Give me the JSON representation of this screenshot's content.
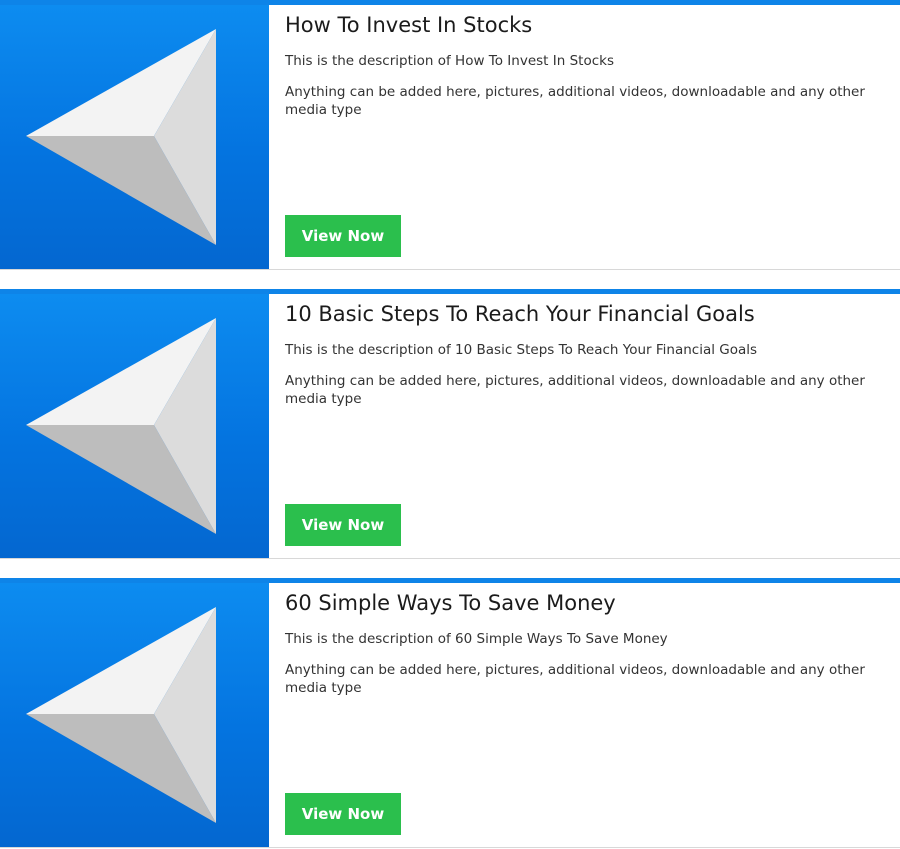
{
  "items": [
    {
      "title": "How To Invest In Stocks",
      "description": "This is the description of How To Invest In Stocks",
      "extra": "Anything can be added here, pictures, additional videos, downloadable and any other media type",
      "button_label": "View Now",
      "thumbnail_icon": "back-arrow-triangle-icon"
    },
    {
      "title": "10 Basic Steps To Reach Your Financial Goals",
      "description": "This is the description of 10 Basic Steps To Reach Your Financial Goals",
      "extra": "Anything can be added here, pictures, additional videos, downloadable and any other media type",
      "button_label": "View Now",
      "thumbnail_icon": "back-arrow-triangle-icon"
    },
    {
      "title": "60 Simple Ways To Save Money",
      "description": "This is the description of 60 Simple Ways To Save Money",
      "extra": "Anything can be added here, pictures, additional videos, downloadable and any other media type",
      "button_label": "View Now",
      "thumbnail_icon": "back-arrow-triangle-icon"
    }
  ],
  "colors": {
    "accent_border": "#0e84e8",
    "thumbnail_bg": "#0474e0",
    "button_bg": "#2bbf4d",
    "button_text": "#ffffff",
    "title_text": "#1b1b1b"
  }
}
